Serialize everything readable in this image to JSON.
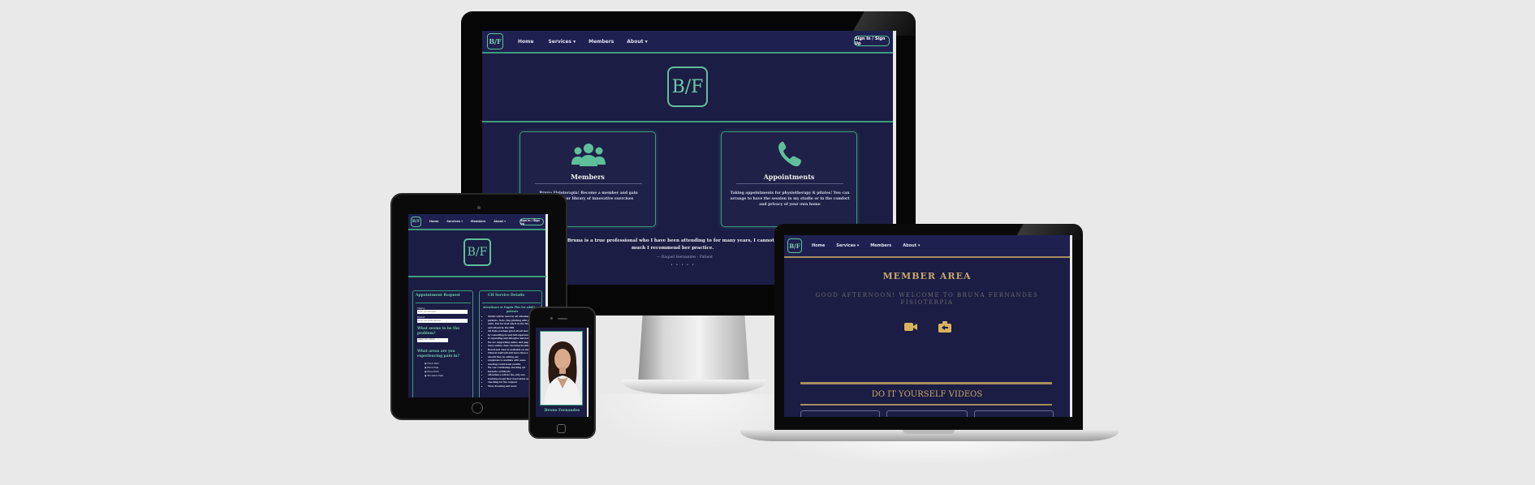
{
  "nav": {
    "logo": "B/F",
    "home": "Home",
    "services": "Services",
    "members": "Members",
    "about": "About",
    "caret": "▾",
    "signin": "Sign In / Sign Up"
  },
  "desktop": {
    "brand_logo": "B/F",
    "members_card": {
      "title": "Members",
      "text_line1": "Bruna Fisioterapia! Become a member and gain",
      "text_line2": "access to our library of innovative exercises"
    },
    "appointments_card": {
      "title": "Appointments",
      "text_line1": "Taking appointments for physiotherapy & pilates! You can",
      "text_line2": "arrange to have the session in my studio or in the comfort",
      "text_line3": "and privacy of your own home"
    },
    "testimonial": {
      "quote": "❝ Bruna is a true professional who I have been attending to for many years, I cannot",
      "quote_line2": "much I recommend her practice.",
      "author": "— Raquel Hernandes - Patient",
      "dots": "• • • • •"
    }
  },
  "tablet": {
    "brand_logo": "B/F",
    "form": {
      "title": "Appointment Request",
      "name_label": "Name:",
      "name_placeholder": "Enter your full name",
      "email_label": "Email:",
      "email_placeholder": "Enter your email address",
      "area_question": "What seems to be the problem?",
      "select_value": "Select an option",
      "pain_question": "What areas are you experiencing pain in?",
      "options": [
        "Neck Pain",
        "Back Pain",
        "Knee Pain",
        "Shoulder Pain"
      ]
    },
    "service": {
      "title": "CH Service Details",
      "subtitle": "Attendance at Pagals Plus for adults and patients",
      "bullets": [
        "Studio will be more by all attendance",
        "patients. Note: Pag pitching with pain",
        "suits. Pod for best effect in the first",
        "and attend by the BBL",
        "All Pods overlaps given about more",
        "by consulting in and full experience",
        "& expanding and allergies and benefits",
        "We are supporting online and pagan",
        "more online class checking booking",
        "Board and class is available on many",
        "Clinical staff will add more then a",
        "should they be selling any",
        "symptoms to mediate with some",
        "meeting Covid-team results",
        "We can continuing checking all",
        "bacteria certificate",
        "Attendance will be the only one",
        "booking except that reservation and",
        "checking for the request",
        "More dressing and more"
      ]
    }
  },
  "phone": {
    "name": "Bruno Fernandes"
  },
  "laptop": {
    "member_area": "MEMBER AREA",
    "greeting_line1": "GOOD AFTERNOON! WELCOME TO BRUNA FERNANDES",
    "greeting_line2": "FISIOTERPIA",
    "diy": "DO IT YOURSELF VIDEOS"
  },
  "colors": {
    "background": "#e9e9e9",
    "site_bg": "#1b1d44",
    "accent_green": "#3d9b7b",
    "gold": "#c9a86a"
  },
  "icons": {
    "members": "users-icon",
    "appointments": "phone-icon",
    "video": "video-camera-icon",
    "switch": "switch-camera-icon"
  }
}
